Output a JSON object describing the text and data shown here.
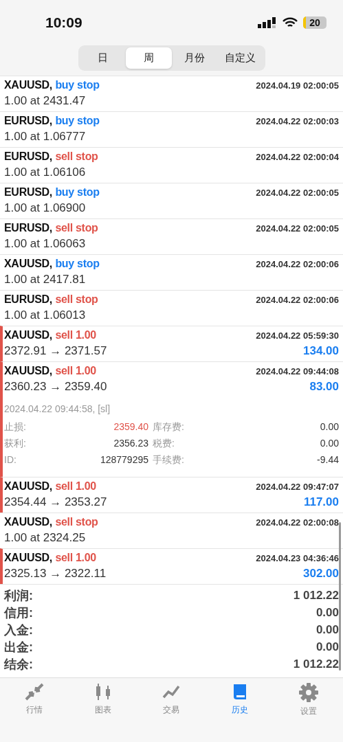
{
  "status_bar": {
    "time": "10:09",
    "battery": "20"
  },
  "period_tabs": [
    {
      "label": "日",
      "selected": false
    },
    {
      "label": "周",
      "selected": true
    },
    {
      "label": "月份",
      "selected": false
    },
    {
      "label": "自定义",
      "selected": false
    }
  ],
  "history": [
    {
      "kind": "order",
      "symbol": "XAUUSD,",
      "color": "#1a7ef0",
      "action": "buy stop",
      "time": "2024.04.19 02:00:05",
      "detail": "1.00 at 2431.47"
    },
    {
      "kind": "order",
      "symbol": "EURUSD,",
      "color": "#1a7ef0",
      "action": "buy stop",
      "time": "2024.04.22 02:00:03",
      "detail": "1.00 at 1.06777"
    },
    {
      "kind": "order",
      "symbol": "EURUSD,",
      "color": "#e0534a",
      "action": "sell stop",
      "time": "2024.04.22 02:00:04",
      "detail": "1.00 at 1.06106"
    },
    {
      "kind": "order",
      "symbol": "EURUSD,",
      "color": "#1a7ef0",
      "action": "buy stop",
      "time": "2024.04.22 02:00:05",
      "detail": "1.00 at 1.06900"
    },
    {
      "kind": "order",
      "symbol": "EURUSD,",
      "color": "#e0534a",
      "action": "sell stop",
      "time": "2024.04.22 02:00:05",
      "detail": "1.00 at 1.06063"
    },
    {
      "kind": "order",
      "symbol": "XAUUSD,",
      "color": "#1a7ef0",
      "action": "buy stop",
      "time": "2024.04.22 02:00:06",
      "detail": "1.00 at 2417.81"
    },
    {
      "kind": "order",
      "symbol": "EURUSD,",
      "color": "#e0534a",
      "action": "sell stop",
      "time": "2024.04.22 02:00:06",
      "detail": "1.00 at 1.06013"
    },
    {
      "kind": "deal",
      "symbol": "XAUUSD,",
      "color": "#e0534a",
      "action": "sell 1.00",
      "time": "2024.04.22 05:59:30",
      "detail": "2372.91 → 2371.57",
      "profit": "134.00",
      "expanded": false
    },
    {
      "kind": "deal",
      "symbol": "XAUUSD,",
      "color": "#e0534a",
      "action": "sell 1.00",
      "time": "2024.04.22 09:44:08",
      "detail": "2360.23 → 2359.40",
      "profit": "83.00",
      "expanded": true,
      "close_info": "2024.04.22 09:44:58, [sl]",
      "fields": [
        {
          "label": "止损:",
          "value": "2359.40",
          "alert": true
        },
        {
          "label": "库存费:",
          "value": "0.00",
          "alert": false
        },
        {
          "label": "获利:",
          "value": "2356.23",
          "alert": false
        },
        {
          "label": "税费:",
          "value": "0.00",
          "alert": false
        },
        {
          "label": "ID:",
          "value": "128779295",
          "alert": false
        },
        {
          "label": "手续费:",
          "value": "-9.44",
          "alert": false
        }
      ]
    },
    {
      "kind": "deal",
      "symbol": "XAUUSD,",
      "color": "#e0534a",
      "action": "sell 1.00",
      "time": "2024.04.22 09:47:07",
      "detail": "2354.44 → 2353.27",
      "profit": "117.00",
      "expanded": false
    },
    {
      "kind": "order",
      "symbol": "XAUUSD,",
      "color": "#e0534a",
      "action": "sell stop",
      "time": "2024.04.22 02:00:08",
      "detail": "1.00 at 2324.25"
    },
    {
      "kind": "deal",
      "symbol": "XAUUSD,",
      "color": "#e0534a",
      "action": "sell 1.00",
      "time": "2024.04.23 04:36:46",
      "detail": "2325.13 → 2322.11",
      "profit": "302.00",
      "expanded": false
    }
  ],
  "summary": [
    {
      "label": "利润:",
      "value": "1 012.22"
    },
    {
      "label": "信用:",
      "value": "0.00"
    },
    {
      "label": "入金:",
      "value": "0.00"
    },
    {
      "label": "出金:",
      "value": "0.00"
    },
    {
      "label": "结余:",
      "value": "1 012.22"
    }
  ],
  "tab_bar": [
    {
      "kind": "quotes",
      "label": "行情",
      "selected": false
    },
    {
      "kind": "charts",
      "label": "图表",
      "selected": false
    },
    {
      "kind": "trade",
      "label": "交易",
      "selected": false
    },
    {
      "kind": "history",
      "label": "历史",
      "selected": true
    },
    {
      "kind": "settings",
      "label": "设置",
      "selected": false
    }
  ]
}
